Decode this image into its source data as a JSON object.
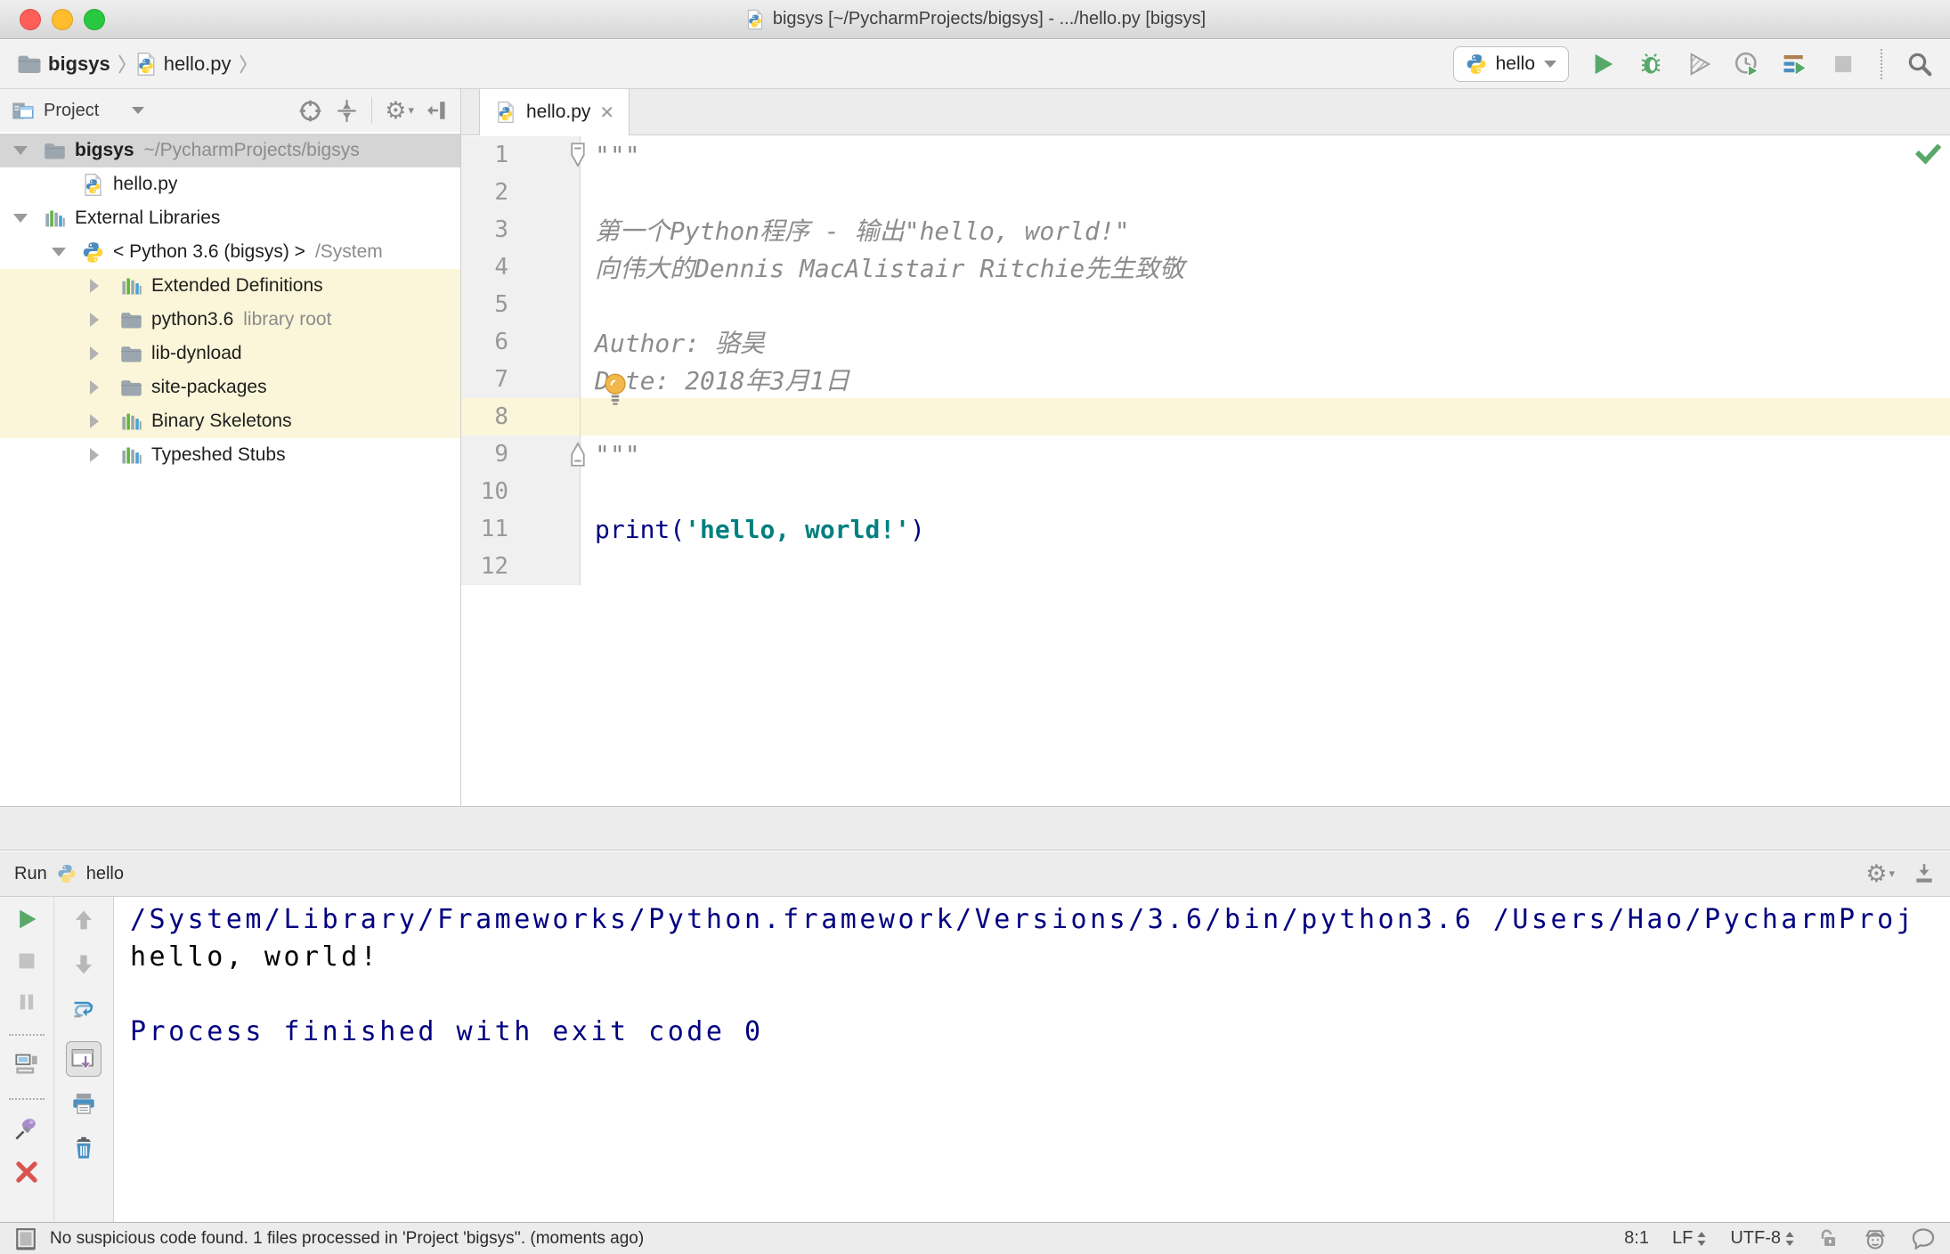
{
  "colors": {
    "accent_keyword": "#000080",
    "string": "#008080",
    "docstring": "#8c8c8c",
    "caret_line": "#fbf6d9",
    "library_row_highlight": "#fbf6d9",
    "selection_inactive": "#d5d5d5",
    "run_green": "#59A869",
    "console_system": "#000080"
  },
  "titlebar": {
    "title": "bigsys [~/PycharmProjects/bigsys] - .../hello.py [bigsys]"
  },
  "navbar": {
    "breadcrumbs": [
      {
        "label": "bigsys",
        "icon": "folder-icon"
      },
      {
        "label": "hello.py",
        "icon": "python-file-icon"
      }
    ],
    "run_config": {
      "value": "hello",
      "icon": "python-icon"
    },
    "actions": [
      "run-icon",
      "debug-icon",
      "run-coverage-icon",
      "profiler-icon",
      "concurrency-diagram-icon",
      "stop-icon",
      "search-everywhere-icon"
    ]
  },
  "project_panel": {
    "title": "Project",
    "header_icons": [
      "locate-icon",
      "collapse-all-icon",
      "settings-gear-icon",
      "hide-panel-icon"
    ],
    "tree": [
      {
        "label": "bigsys",
        "suffix": "~/PycharmProjects/bigsys",
        "icon": "folder",
        "arrow": "down",
        "level": 0,
        "selected": true,
        "bold": true
      },
      {
        "label": "hello.py",
        "suffix": "",
        "icon": "python-file",
        "arrow": "",
        "level": 1
      },
      {
        "label": "External Libraries",
        "suffix": "",
        "icon": "library",
        "arrow": "down",
        "level": 0
      },
      {
        "label": "< Python 3.6 (bigsys) >",
        "suffix": "/System",
        "icon": "python",
        "arrow": "down",
        "level": 1
      },
      {
        "label": "Extended Definitions",
        "suffix": "",
        "icon": "library",
        "arrow": "right",
        "level": 2,
        "highlight": true
      },
      {
        "label": "python3.6",
        "suffix": "library root",
        "icon": "folder",
        "arrow": "right",
        "level": 2,
        "highlight": true
      },
      {
        "label": "lib-dynload",
        "suffix": "",
        "icon": "folder",
        "arrow": "right",
        "level": 2,
        "highlight": true
      },
      {
        "label": "site-packages",
        "suffix": "",
        "icon": "folder",
        "arrow": "right",
        "level": 2,
        "highlight": true
      },
      {
        "label": "Binary Skeletons",
        "suffix": "",
        "icon": "library",
        "arrow": "right",
        "level": 2,
        "highlight": true
      },
      {
        "label": "Typeshed Stubs",
        "suffix": "",
        "icon": "library",
        "arrow": "right",
        "level": 2
      }
    ]
  },
  "editor": {
    "tab": {
      "label": "hello.py",
      "close": "✕"
    },
    "lines": [
      {
        "n": "1",
        "fold": "top",
        "caret": false,
        "segments": [
          {
            "t": "\"\"\"",
            "c": "doc"
          }
        ]
      },
      {
        "n": "2",
        "fold": "",
        "caret": false,
        "segments": []
      },
      {
        "n": "3",
        "fold": "",
        "caret": false,
        "segments": [
          {
            "t": "第一个Python程序 - 输出\"hello, world!\"",
            "c": "doc"
          }
        ]
      },
      {
        "n": "4",
        "fold": "",
        "caret": false,
        "segments": [
          {
            "t": "向伟大的Dennis MacAlistair Ritchie先生致敬",
            "c": "doc"
          }
        ]
      },
      {
        "n": "5",
        "fold": "",
        "caret": false,
        "segments": []
      },
      {
        "n": "6",
        "fold": "",
        "caret": false,
        "segments": [
          {
            "t": "Author: 骆昊",
            "c": "doc"
          }
        ]
      },
      {
        "n": "7",
        "fold": "",
        "caret": false,
        "segments": [
          {
            "t": "Date: 2018年3月1日",
            "c": "doc"
          }
        ]
      },
      {
        "n": "8",
        "fold": "",
        "caret": true,
        "segments": []
      },
      {
        "n": "9",
        "fold": "bottom",
        "caret": false,
        "segments": [
          {
            "t": "\"\"\"",
            "c": "doc"
          }
        ]
      },
      {
        "n": "10",
        "fold": "",
        "caret": false,
        "segments": []
      },
      {
        "n": "11",
        "fold": "",
        "caret": false,
        "segments": [
          {
            "t": "print",
            "c": "kw"
          },
          {
            "t": "(",
            "c": "plain"
          },
          {
            "t": "'hello, world!'",
            "c": "str"
          },
          {
            "t": ")",
            "c": "plain"
          }
        ]
      },
      {
        "n": "12",
        "fold": "",
        "caret": false,
        "segments": []
      }
    ]
  },
  "run_panel": {
    "title": "Run",
    "config_name": "hello",
    "header_icons": [
      "settings-gear-icon",
      "hide-panel-down-icon"
    ],
    "toolbar_left": [
      "rerun-icon",
      "stop-icon",
      "pause-output-icon",
      "restore-layout-icon",
      "pin-tab-icon",
      "close-icon",
      "more-options"
    ],
    "toolbar_left2": [
      "up-stack-trace-icon",
      "down-stack-trace-icon",
      "soft-wrap-icon",
      "scroll-to-end-icon",
      "print-icon",
      "clear-all-icon"
    ],
    "more_label": "»",
    "console": [
      {
        "text": "/System/Library/Frameworks/Python.framework/Versions/3.6/bin/python3.6 /Users/Hao/PycharmProj",
        "c": "system"
      },
      {
        "text": "hello, world!",
        "c": "stdout"
      },
      {
        "text": "",
        "c": "stdout"
      },
      {
        "text": "Process finished with exit code 0",
        "c": "system"
      }
    ]
  },
  "statusbar": {
    "message": "No suspicious code found. 1 files processed in 'Project 'bigsys''. (moments ago)",
    "caret_position": "8:1",
    "line_separator": "LF",
    "encoding": "UTF-8",
    "right_icons": [
      "lock-icon",
      "hector-inspector-icon",
      "feedback-bubble-icon"
    ]
  }
}
